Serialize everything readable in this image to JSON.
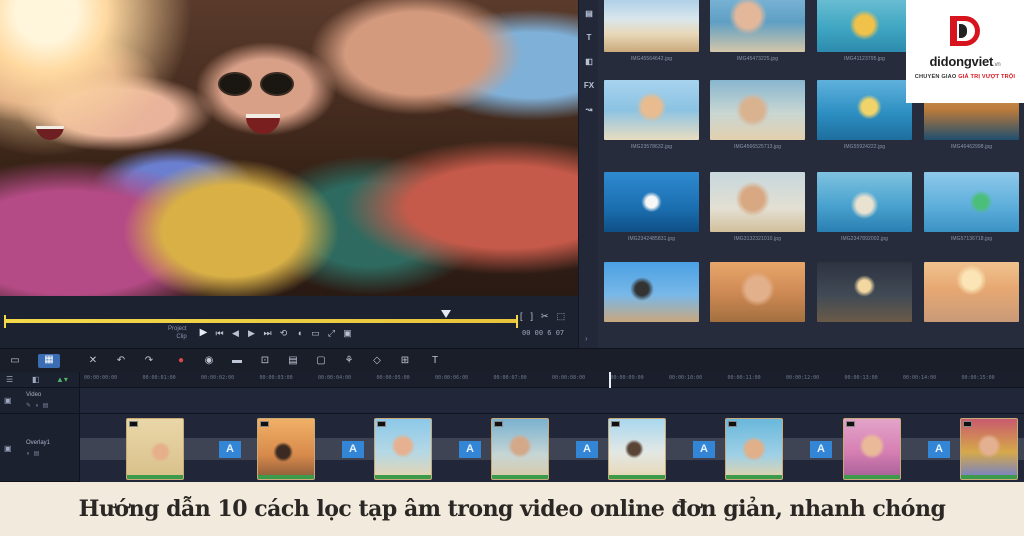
{
  "app": {
    "playback": {
      "mode_labels": [
        "Project",
        "Clip"
      ],
      "controls": [
        "play-icon",
        "to-start-icon",
        "prev-frame-icon",
        "next-frame-icon",
        "to-end-icon",
        "repeat-icon",
        "volume-icon",
        "resolution-icon",
        "enlarge-icon",
        "snapshot-icon"
      ],
      "timecode": "00 00 6 07"
    },
    "side_toolbar": [
      "media-icon",
      "title-icon",
      "transition-icon",
      "filter-icon",
      "path-icon"
    ],
    "library": {
      "items": [
        {
          "caption": "IMG45564642.jpg"
        },
        {
          "caption": "IMG45473225.jpg"
        },
        {
          "caption": "IMG41123795.jpg"
        },
        {
          "caption": ""
        },
        {
          "caption": "IMG23578632.jpg"
        },
        {
          "caption": "IMG4566525713.jpg"
        },
        {
          "caption": "IMG55924222.jpg"
        },
        {
          "caption": "IMG46462998.jpg"
        },
        {
          "caption": "IMG2342485831.jpg"
        },
        {
          "caption": "IMG3132321010.jpg"
        },
        {
          "caption": "IMG2347892002.jpg"
        },
        {
          "caption": "IMG57136718.jpg"
        },
        {
          "caption": ""
        },
        {
          "caption": ""
        },
        {
          "caption": ""
        },
        {
          "caption": ""
        }
      ]
    },
    "timeline": {
      "ticks": [
        "00:00:00:00",
        "00:00:01:00",
        "00:00:02:00",
        "00:00:03:00",
        "00:00:04:00",
        "00:00:05:00",
        "00:00:06:00",
        "00:00:07:00",
        "00:00:08:00",
        "00:00:09:00",
        "00:00:10:00",
        "00:00:11:00",
        "00:00:12:00",
        "00:00:13:00",
        "00:00:14:00",
        "00:00:15:00"
      ],
      "tracks": [
        {
          "name": "Video"
        },
        {
          "name": "Overlay1"
        }
      ],
      "transition_label": "A"
    }
  },
  "logo": {
    "name": "didongviet",
    "name_suffix": ".vn",
    "slogan_prefix": "CHUYỂN GIAO",
    "slogan_highlight": "GIÁ TRỊ VƯỢT TRỘI"
  },
  "caption": "Hướng dẫn 10 cách lọc tạp âm trong video online đơn giản, nhanh chóng",
  "colors": {
    "accent_yellow": "#f3d94a",
    "transition_blue": "#3386d6",
    "brand_red": "#d7131d"
  }
}
